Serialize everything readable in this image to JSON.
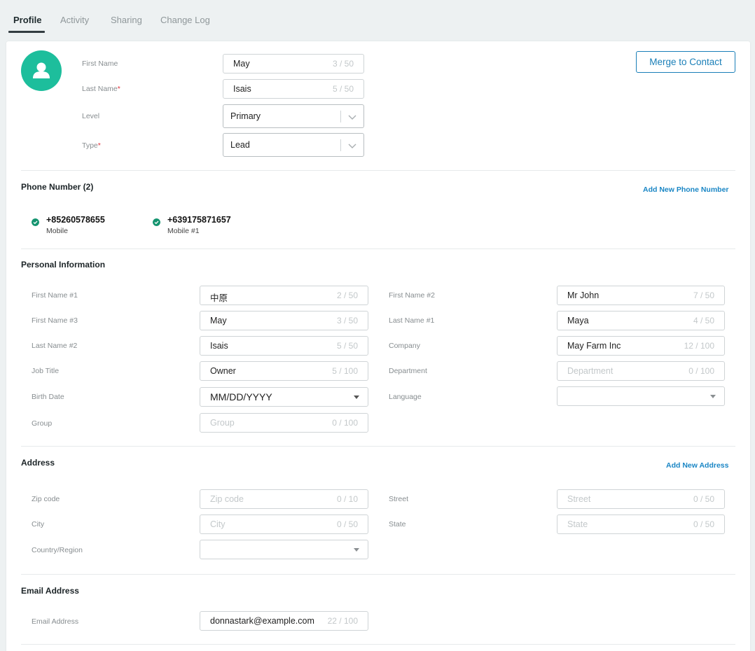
{
  "tabs": [
    {
      "label": "Profile"
    },
    {
      "label": "Activity"
    },
    {
      "label": "Sharing"
    },
    {
      "label": "Change Log"
    }
  ],
  "header": {
    "first_name_label": "First Name",
    "first_name_value": "May",
    "first_name_count": "3 / 50",
    "last_name_label": "Last Name",
    "last_name_value": "Isais",
    "last_name_count": "5 / 50",
    "level_label": "Level",
    "level_value": "Primary",
    "type_label": "Type",
    "type_value": "Lead",
    "required_mark": "*",
    "merge_button": "Merge to Contact"
  },
  "phone": {
    "title": "Phone Number (2)",
    "add_link": "Add New Phone Number",
    "numbers": [
      {
        "number": "+85260578655",
        "type": "Mobile"
      },
      {
        "number": "+639175871657",
        "type": "Mobile #1"
      }
    ]
  },
  "personal": {
    "title": "Personal Information",
    "first_name_1": {
      "label": "First Name #1",
      "value": "中原",
      "count": "2 / 50"
    },
    "first_name_2": {
      "label": "First Name #2",
      "value": "Mr John",
      "count": "7 / 50"
    },
    "first_name_3": {
      "label": "First Name #3",
      "value": "May",
      "count": "3 / 50"
    },
    "last_name_1": {
      "label": "Last Name #1",
      "value": "Maya",
      "count": "4 / 50"
    },
    "last_name_2": {
      "label": "Last Name #2",
      "value": "Isais",
      "count": "5 / 50"
    },
    "company": {
      "label": "Company",
      "value": "May Farm Inc",
      "count": "12 / 100"
    },
    "job_title": {
      "label": "Job Title",
      "value": "Owner",
      "count": "5 / 100"
    },
    "department": {
      "label": "Department",
      "placeholder": "Department",
      "count": "0 / 100"
    },
    "birth_date": {
      "label": "Birth Date",
      "value": "MM/DD/YYYY"
    },
    "language": {
      "label": "Language",
      "value": ""
    },
    "group": {
      "label": "Group",
      "placeholder": "Group",
      "count": "0 / 100"
    }
  },
  "address": {
    "title": "Address",
    "add_link": "Add New Address",
    "zip": {
      "label": "Zip code",
      "placeholder": "Zip code",
      "count": "0 / 10"
    },
    "street": {
      "label": "Street",
      "placeholder": "Street",
      "count": "0 / 50"
    },
    "city": {
      "label": "City",
      "placeholder": "City",
      "count": "0 / 50"
    },
    "state": {
      "label": "State",
      "placeholder": "State",
      "count": "0 / 50"
    },
    "country": {
      "label": "Country/Region",
      "value": ""
    }
  },
  "email": {
    "title": "Email Address",
    "label": "Email Address",
    "value": "donnastark@example.com",
    "count": "22 / 100"
  },
  "icons": [
    "avatar-person-icon",
    "chevron-down-icon",
    "check-circle-icon",
    "caret-down-icon"
  ],
  "colors": {
    "accent": "#1a7fb8",
    "link": "#1a86c5",
    "avatar": "#1dbe9c",
    "check": "#14946f",
    "required": "#e0323c"
  }
}
